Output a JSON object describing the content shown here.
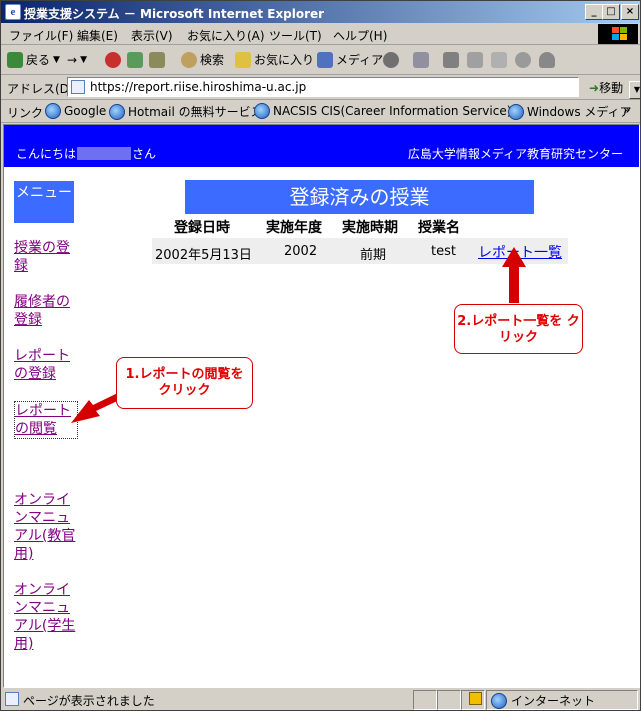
{
  "window": {
    "title": "授業支援システム － Microsoft Internet Explorer",
    "controls": {
      "minimize": "_",
      "maximize": "□",
      "close": "×"
    }
  },
  "menu": [
    "ファイル(F)",
    "編集(E)",
    "表示(V)",
    "お気に入り(A)",
    "ツール(T)",
    "ヘルプ(H)"
  ],
  "toolbar": {
    "back": "戻る",
    "forward": "→",
    "search": "検索",
    "favorites": "お気に入り",
    "media": "メディア"
  },
  "address": {
    "label": "アドレス(D)",
    "url": "https://report.riise.hiroshima-u.ac.jp",
    "go": "移動"
  },
  "links": {
    "label": "リンク",
    "items": [
      "Google",
      "Hotmail の無料サービス",
      "NACSIS CIS(Career Information Service)-J",
      "Windows メディア"
    ],
    "more": "»"
  },
  "page": {
    "greeting_prefix": "こんにちは",
    "greeting_suffix": "さん",
    "center_name": "広島大学情報メディア教育研究センター",
    "menu_title": "メニュー",
    "nav": [
      "授業の登録",
      "履修者の登録",
      "レポートの登録",
      "レポートの閲覧",
      "オンラインマニュアル(教官用)",
      "オンラインマニュアル(学生用)"
    ],
    "heading": "登録済みの授業",
    "columns": [
      "登録日時",
      "実施年度",
      "実施時期",
      "授業名"
    ],
    "row": {
      "date": "2002年5月13日",
      "year": "2002",
      "term": "前期",
      "name": "test",
      "link": "レポート一覧"
    }
  },
  "annotations": {
    "callout1": "1.レポートの閲覧を クリック",
    "callout2": "2.レポート一覧を クリック",
    "color": "#d40000"
  },
  "status": {
    "text": "ページが表示されました",
    "zone": "インターネット"
  }
}
